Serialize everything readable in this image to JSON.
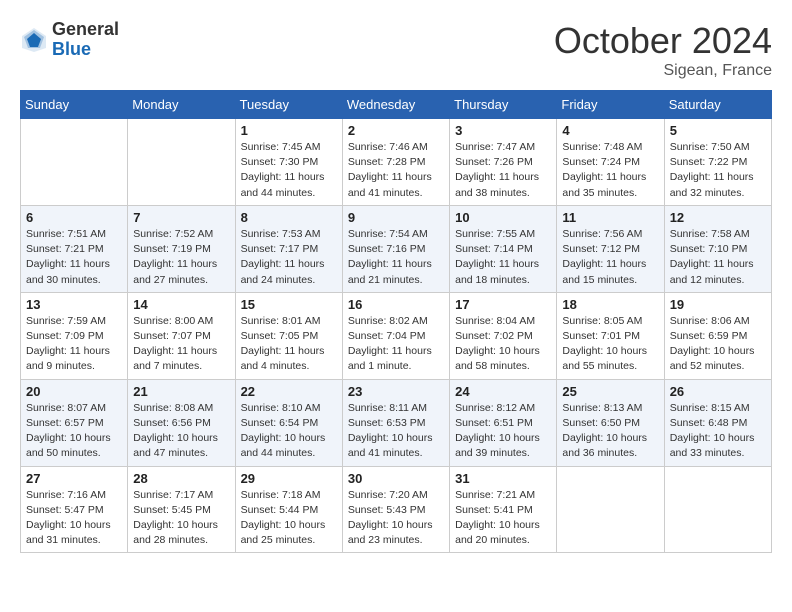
{
  "header": {
    "logo_general": "General",
    "logo_blue": "Blue",
    "month_title": "October 2024",
    "location": "Sigean, France"
  },
  "weekdays": [
    "Sunday",
    "Monday",
    "Tuesday",
    "Wednesday",
    "Thursday",
    "Friday",
    "Saturday"
  ],
  "weeks": [
    [
      {
        "day": "",
        "sunrise": "",
        "sunset": "",
        "daylight": ""
      },
      {
        "day": "",
        "sunrise": "",
        "sunset": "",
        "daylight": ""
      },
      {
        "day": "1",
        "sunrise": "Sunrise: 7:45 AM",
        "sunset": "Sunset: 7:30 PM",
        "daylight": "Daylight: 11 hours and 44 minutes."
      },
      {
        "day": "2",
        "sunrise": "Sunrise: 7:46 AM",
        "sunset": "Sunset: 7:28 PM",
        "daylight": "Daylight: 11 hours and 41 minutes."
      },
      {
        "day": "3",
        "sunrise": "Sunrise: 7:47 AM",
        "sunset": "Sunset: 7:26 PM",
        "daylight": "Daylight: 11 hours and 38 minutes."
      },
      {
        "day": "4",
        "sunrise": "Sunrise: 7:48 AM",
        "sunset": "Sunset: 7:24 PM",
        "daylight": "Daylight: 11 hours and 35 minutes."
      },
      {
        "day": "5",
        "sunrise": "Sunrise: 7:50 AM",
        "sunset": "Sunset: 7:22 PM",
        "daylight": "Daylight: 11 hours and 32 minutes."
      }
    ],
    [
      {
        "day": "6",
        "sunrise": "Sunrise: 7:51 AM",
        "sunset": "Sunset: 7:21 PM",
        "daylight": "Daylight: 11 hours and 30 minutes."
      },
      {
        "day": "7",
        "sunrise": "Sunrise: 7:52 AM",
        "sunset": "Sunset: 7:19 PM",
        "daylight": "Daylight: 11 hours and 27 minutes."
      },
      {
        "day": "8",
        "sunrise": "Sunrise: 7:53 AM",
        "sunset": "Sunset: 7:17 PM",
        "daylight": "Daylight: 11 hours and 24 minutes."
      },
      {
        "day": "9",
        "sunrise": "Sunrise: 7:54 AM",
        "sunset": "Sunset: 7:16 PM",
        "daylight": "Daylight: 11 hours and 21 minutes."
      },
      {
        "day": "10",
        "sunrise": "Sunrise: 7:55 AM",
        "sunset": "Sunset: 7:14 PM",
        "daylight": "Daylight: 11 hours and 18 minutes."
      },
      {
        "day": "11",
        "sunrise": "Sunrise: 7:56 AM",
        "sunset": "Sunset: 7:12 PM",
        "daylight": "Daylight: 11 hours and 15 minutes."
      },
      {
        "day": "12",
        "sunrise": "Sunrise: 7:58 AM",
        "sunset": "Sunset: 7:10 PM",
        "daylight": "Daylight: 11 hours and 12 minutes."
      }
    ],
    [
      {
        "day": "13",
        "sunrise": "Sunrise: 7:59 AM",
        "sunset": "Sunset: 7:09 PM",
        "daylight": "Daylight: 11 hours and 9 minutes."
      },
      {
        "day": "14",
        "sunrise": "Sunrise: 8:00 AM",
        "sunset": "Sunset: 7:07 PM",
        "daylight": "Daylight: 11 hours and 7 minutes."
      },
      {
        "day": "15",
        "sunrise": "Sunrise: 8:01 AM",
        "sunset": "Sunset: 7:05 PM",
        "daylight": "Daylight: 11 hours and 4 minutes."
      },
      {
        "day": "16",
        "sunrise": "Sunrise: 8:02 AM",
        "sunset": "Sunset: 7:04 PM",
        "daylight": "Daylight: 11 hours and 1 minute."
      },
      {
        "day": "17",
        "sunrise": "Sunrise: 8:04 AM",
        "sunset": "Sunset: 7:02 PM",
        "daylight": "Daylight: 10 hours and 58 minutes."
      },
      {
        "day": "18",
        "sunrise": "Sunrise: 8:05 AM",
        "sunset": "Sunset: 7:01 PM",
        "daylight": "Daylight: 10 hours and 55 minutes."
      },
      {
        "day": "19",
        "sunrise": "Sunrise: 8:06 AM",
        "sunset": "Sunset: 6:59 PM",
        "daylight": "Daylight: 10 hours and 52 minutes."
      }
    ],
    [
      {
        "day": "20",
        "sunrise": "Sunrise: 8:07 AM",
        "sunset": "Sunset: 6:57 PM",
        "daylight": "Daylight: 10 hours and 50 minutes."
      },
      {
        "day": "21",
        "sunrise": "Sunrise: 8:08 AM",
        "sunset": "Sunset: 6:56 PM",
        "daylight": "Daylight: 10 hours and 47 minutes."
      },
      {
        "day": "22",
        "sunrise": "Sunrise: 8:10 AM",
        "sunset": "Sunset: 6:54 PM",
        "daylight": "Daylight: 10 hours and 44 minutes."
      },
      {
        "day": "23",
        "sunrise": "Sunrise: 8:11 AM",
        "sunset": "Sunset: 6:53 PM",
        "daylight": "Daylight: 10 hours and 41 minutes."
      },
      {
        "day": "24",
        "sunrise": "Sunrise: 8:12 AM",
        "sunset": "Sunset: 6:51 PM",
        "daylight": "Daylight: 10 hours and 39 minutes."
      },
      {
        "day": "25",
        "sunrise": "Sunrise: 8:13 AM",
        "sunset": "Sunset: 6:50 PM",
        "daylight": "Daylight: 10 hours and 36 minutes."
      },
      {
        "day": "26",
        "sunrise": "Sunrise: 8:15 AM",
        "sunset": "Sunset: 6:48 PM",
        "daylight": "Daylight: 10 hours and 33 minutes."
      }
    ],
    [
      {
        "day": "27",
        "sunrise": "Sunrise: 7:16 AM",
        "sunset": "Sunset: 5:47 PM",
        "daylight": "Daylight: 10 hours and 31 minutes."
      },
      {
        "day": "28",
        "sunrise": "Sunrise: 7:17 AM",
        "sunset": "Sunset: 5:45 PM",
        "daylight": "Daylight: 10 hours and 28 minutes."
      },
      {
        "day": "29",
        "sunrise": "Sunrise: 7:18 AM",
        "sunset": "Sunset: 5:44 PM",
        "daylight": "Daylight: 10 hours and 25 minutes."
      },
      {
        "day": "30",
        "sunrise": "Sunrise: 7:20 AM",
        "sunset": "Sunset: 5:43 PM",
        "daylight": "Daylight: 10 hours and 23 minutes."
      },
      {
        "day": "31",
        "sunrise": "Sunrise: 7:21 AM",
        "sunset": "Sunset: 5:41 PM",
        "daylight": "Daylight: 10 hours and 20 minutes."
      },
      {
        "day": "",
        "sunrise": "",
        "sunset": "",
        "daylight": ""
      },
      {
        "day": "",
        "sunrise": "",
        "sunset": "",
        "daylight": ""
      }
    ]
  ]
}
